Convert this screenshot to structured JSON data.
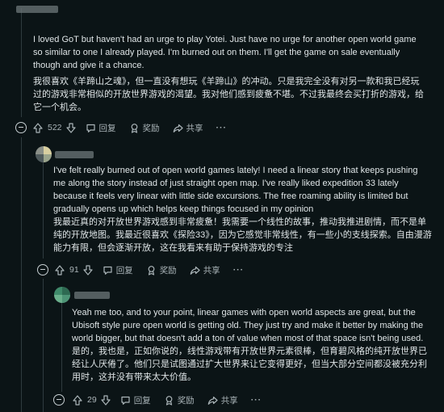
{
  "comments": [
    {
      "body_en": "I loved GoT but haven't had an urge to play Yotei. Just have no urge for another open world game so similar to one I already played. I'm burned out on them.  I'll get the game on sale eventually though and give it a chance.",
      "body_zh": "我很喜欢《羊蹄山之魂》，但一直没有想玩《羊蹄山》的冲动。只是我完全没有对另一款和我已经玩过的游戏非常相似的开放世界游戏的渴望。我对他们感到疲惫不堪。不过我最终会买打折的游戏，给它一个机会。",
      "votes": "522",
      "reply_label": "回复",
      "award_label": "奖励",
      "share_label": "共享",
      "more_label": "···"
    },
    {
      "body_en": "I've felt really burned out of open world games lately! I need a linear story that keeps pushing me along the story instead of just straight open map. I've really liked expedition 33 lately because it feels very linear with little side excursions. The free roaming ability is limited but gradually opens up which helps keep things focused in my opinion",
      "body_zh": "我最近真的对开放世界游戏感到非常疲惫！我需要一个线性的故事，推动我推进剧情，而不是单纯的开放地图。我最近很喜欢《探险33》，因为它感觉非常线性，有一些小的支线探索。自由漫游能力有限，但会逐渐开放，这在我看来有助于保持游戏的专注",
      "votes": "91",
      "reply_label": "回复",
      "award_label": "奖励",
      "share_label": "共享",
      "more_label": "···"
    },
    {
      "body_en": "Yeah me too, and to your point, linear games with open world aspects are great, but the Ubisoft style pure open world is getting old. They just try and make it better by making the world bigger, but that doesn't add a ton of value when most of that space isn't being used.",
      "body_zh": "是的，我也是，正如你说的，线性游戏带有开放世界元素很棒，但育碧风格的纯开放世界已经让人厌倦了。他们只是试图通过扩大世界来让它变得更好，但当大部分空间都没被充分利用时，这并没有带来太大价值。",
      "votes": "29",
      "reply_label": "回复",
      "award_label": "奖励",
      "share_label": "共享",
      "more_label": "···"
    }
  ],
  "colors": {
    "background": "#0b1416",
    "text": "#dfe5e7",
    "muted": "#aab4b8",
    "thread_line": "#2f3b3f"
  }
}
